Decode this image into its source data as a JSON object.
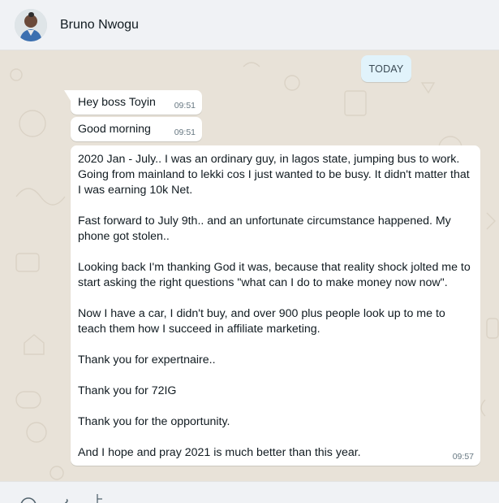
{
  "header": {
    "contact_name": "Bruno Nwogu",
    "avatar_icon": "profile-photo"
  },
  "chat": {
    "date_divider": "TODAY",
    "messages": [
      {
        "text": "Hey boss Toyin",
        "time": "09:51"
      },
      {
        "text": "Good morning",
        "time": "09:51"
      },
      {
        "paragraphs": [
          "2020 Jan - July.. I was an ordinary guy, in lagos state, jumping bus to work. Going from mainland to lekki cos I just wanted to be busy. It didn't matter that I was earning 10k Net.",
          "Fast forward to July 9th.. and an unfortunate circumstance happened. My phone got stolen..",
          "Looking back I'm thanking God it was, because that reality shock jolted me to start asking the right questions \"what can I do to make money now now\".",
          "Now I have a car, I didn't buy, and over 900 plus people look up to me to teach them how I succeed in affiliate marketing.",
          "Thank you for expertnaire..",
          "Thank you for 72IG",
          "Thank you for the opportunity.",
          "And I hope and pray 2021 is much better than this year."
        ],
        "time": "09:57"
      }
    ]
  },
  "footer": {
    "icons": [
      "emoji-icon",
      "attach-icon"
    ]
  },
  "colors": {
    "chat_bg": "#e8e2d8",
    "bubble": "#ffffff",
    "date_chip": "#e1f3fb",
    "header_bg": "#f0f2f5"
  }
}
